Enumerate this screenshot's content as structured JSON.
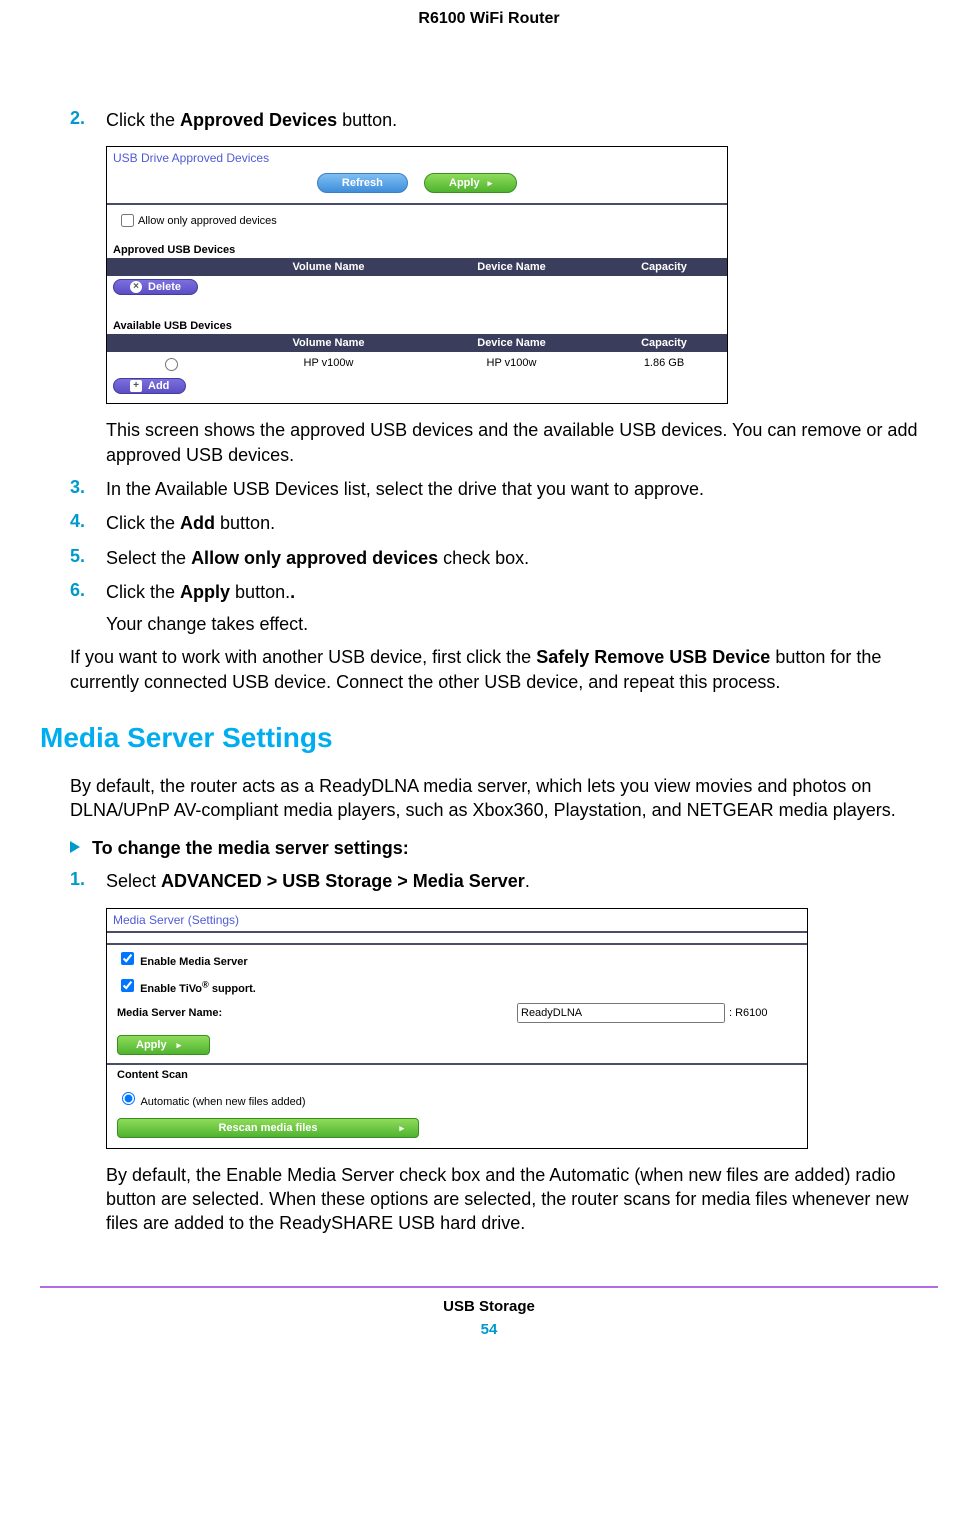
{
  "header": {
    "title": "R6100 WiFi Router"
  },
  "steps_a": [
    {
      "num": "2.",
      "pre": "Click the ",
      "bold": "Approved Devices",
      "post": " button."
    }
  ],
  "sc1": {
    "panel_title": "USB Drive Approved Devices",
    "refresh": "Refresh",
    "apply": "Apply",
    "allow_only": "Allow only approved devices",
    "approved_label": "Approved USB Devices",
    "cols": {
      "vol": "Volume Name",
      "dev": "Device Name",
      "cap": "Capacity"
    },
    "delete": "Delete",
    "available_label": "Available USB Devices",
    "row": {
      "vol": "HP v100w",
      "dev": "HP v100w",
      "cap": "1.86 GB"
    },
    "add": "Add"
  },
  "after_sc1": "This screen shows the approved USB devices and the available USB devices. You can remove or add approved USB devices.",
  "steps_b": [
    {
      "num": "3.",
      "text": "In the Available USB Devices list, select the drive that you want to approve."
    },
    {
      "num": "4.",
      "pre": "Click the ",
      "bold": "Add",
      "post": " button."
    },
    {
      "num": "5.",
      "pre": "Select the ",
      "bold": "Allow only approved devices",
      "post": " check box."
    },
    {
      "num": "6.",
      "pre": "Click the ",
      "bold": "Apply",
      "post": " button."
    }
  ],
  "after6": "Your change takes effect.",
  "safely": {
    "pre": "If you want to work with another USB device, first click the ",
    "bold": "Safely Remove USB Device",
    "post": " button for the currently connected USB device. Connect the other USB device, and repeat this process."
  },
  "section": "Media Server Settings",
  "media_intro": "By default, the router acts as a ReadyDLNA media server, which lets you view movies and photos on DLNA/UPnP AV-compliant media players, such as Xbox360, Playstation, and NETGEAR media players.",
  "task": "To change the media server settings:",
  "step_c": {
    "num": "1.",
    "pre": "Select ",
    "bold": "ADVANCED > USB Storage > Media Server",
    "post": "."
  },
  "sc2": {
    "panel_title": "Media Server (Settings)",
    "enable_media": "Enable Media Server",
    "enable_tivo_pre": "Enable TiVo",
    "enable_tivo_post": " support.",
    "name_label": "Media Server Name:",
    "name_value": "ReadyDLNA",
    "name_suffix": ": R6100",
    "apply": "Apply",
    "content_scan": "Content Scan",
    "automatic": "Automatic (when new files added)",
    "rescan": "Rescan media files"
  },
  "after_sc2": "By default, the Enable Media Server check box and the Automatic (when new files are added) radio button are selected. When these options are selected, the router scans for media files whenever new files are added to the ReadySHARE USB hard drive.",
  "footer": {
    "label": "USB Storage",
    "page": "54"
  }
}
